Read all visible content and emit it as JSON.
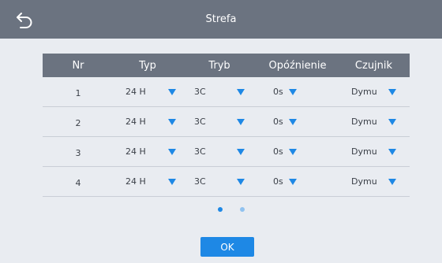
{
  "header": {
    "title": "Strefa",
    "back_icon": "back-arrow-icon"
  },
  "table": {
    "columns": [
      "Nr",
      "Typ",
      "Tryb",
      "Opóźnienie",
      "Czujnik"
    ],
    "rows": [
      {
        "nr": "1",
        "typ": "24 H",
        "tryb": "3C",
        "opoznienie": "0s",
        "czujnik": "Dymu"
      },
      {
        "nr": "2",
        "typ": "24 H",
        "tryb": "3C",
        "opoznienie": "0s",
        "czujnik": "Dymu"
      },
      {
        "nr": "3",
        "typ": "24 H",
        "tryb": "3C",
        "opoznienie": "0s",
        "czujnik": "Dymu"
      },
      {
        "nr": "4",
        "typ": "24 H",
        "tryb": "3C",
        "opoznienie": "0s",
        "czujnik": "Dymu"
      }
    ]
  },
  "pagination": {
    "current_page": 1,
    "total_pages": 2
  },
  "footer": {
    "ok_label": "OK"
  },
  "colors": {
    "accent": "#1e88e5",
    "header_bg": "#6b7380",
    "page_bg": "#e9ecf1"
  }
}
